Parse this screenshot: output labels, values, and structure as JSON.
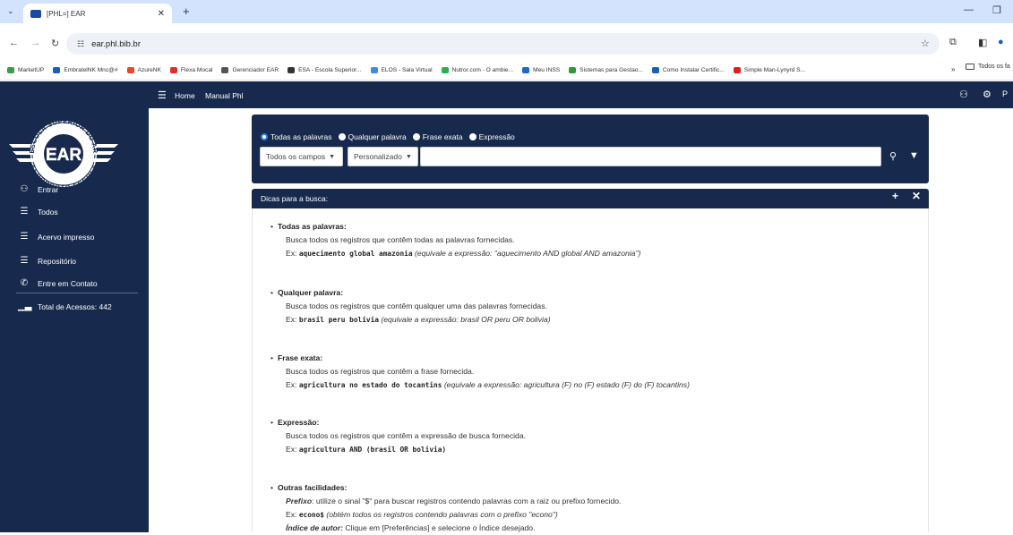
{
  "browser": {
    "tab_title": "[PHL=] EAR",
    "tab_list_icon": "chevron-down-icon",
    "url": "ear.phl.bib.br",
    "bookmarks": [
      {
        "label": "MarketUP",
        "color": "#3c9a4a"
      },
      {
        "label": "EmbratelNK Mnc@#",
        "color": "#1a5fb4"
      },
      {
        "label": "AzureNK",
        "color": "#e24a2a"
      },
      {
        "label": "Flexa Mocal",
        "color": "#e0302c"
      },
      {
        "label": "Gerenciador EAR",
        "color": "#555555"
      },
      {
        "label": "ESA - Escola Superior...",
        "color": "#333333"
      },
      {
        "label": "ELOS - Sala Virtual",
        "color": "#3a8fd8"
      },
      {
        "label": "Nutror.com - O ambie...",
        "color": "#2ab04a"
      },
      {
        "label": "Meu INSS",
        "color": "#1b6ac9"
      },
      {
        "label": "Sistemas para Gestao...",
        "color": "#2a9a3a"
      },
      {
        "label": "Como Instalar Certific...",
        "color": "#1a5fb4"
      },
      {
        "label": "Simple Man-Lynyrd S...",
        "color": "#e02020"
      }
    ],
    "bookmarks_more": "»",
    "bookmarks_folder": "Todos os fa"
  },
  "header": {
    "home": "Home",
    "manual": "Manual Phl",
    "right_text": "P"
  },
  "logo": {
    "top_text": "ESCOLA SUPERIOR DO AR",
    "center_text": "EAR",
    "bottom_text": "AEROPORTO ESCOLA"
  },
  "sidebar": {
    "items": [
      {
        "label": "Entrar",
        "icon": "user-icon"
      },
      {
        "label": "Todos",
        "icon": "stack-icon"
      },
      {
        "label": "Acervo impresso",
        "icon": "stack-icon"
      },
      {
        "label": "Repositório",
        "icon": "stack-icon"
      },
      {
        "label": "Entre em Contato",
        "icon": "phone-icon"
      }
    ],
    "total_label": "Total de Acessos: 442"
  },
  "search": {
    "radios": [
      "Todas as palavras",
      "Qualquer palavra",
      "Frase exata",
      "Expressão"
    ],
    "selected_radio": 0,
    "field_select": "Todos os campos",
    "mode_select": "Personalizado",
    "query": ""
  },
  "tips": {
    "header": "Dicas para a busca:",
    "items": [
      {
        "title": "Todas as palavras:",
        "desc": "Busca todos os registros que contêm todas as palavras fornecidas.",
        "ex_prefix": "Ex:",
        "ex_code": "aquecimento global amazonia",
        "ex_note": "(equivale a expressão: \"aquecimento AND global AND amazonia\")"
      },
      {
        "title": "Qualquer palavra:",
        "desc": "Busca todos os registros que contêm qualquer uma das palavras fornecidas.",
        "ex_prefix": "Ex:",
        "ex_code": "brasil peru bolivia",
        "ex_note": "(equivale a expressão: brasil OR peru OR bolivia)"
      },
      {
        "title": "Frase exata:",
        "desc": "Busca todos os registros que contêm a frase fornecida.",
        "ex_prefix": "Ex:",
        "ex_code": "agricultura no estado do tocantins",
        "ex_note": "(equivale a expressão: agricultura (F) no (F) estado (F) do (F) tocantins)"
      },
      {
        "title": "Expressão:",
        "desc": "Busca todos os registros que contêm a expressão de busca fornecida.",
        "ex_prefix": "Ex:",
        "ex_code": "agricultura AND (brasil OR bolivia)",
        "ex_note": ""
      }
    ],
    "other": {
      "title": "Outras facilidades:",
      "prefix_label": "Prefixo",
      "prefix_desc": ": utilize o sinal \"$\" para buscar registros contendo palavras com a raiz ou prefixo fornecido.",
      "ex_prefix": "Ex:",
      "ex_code": "econo$",
      "ex_note": "(obtém todos os registros contendo palavras com o prefixo \"econo\")",
      "author_label": "Índice de autor:",
      "author_desc": " Clique em [Preferências] e selecione o Índice desejado."
    }
  },
  "colors": {
    "navy": "#172a4d",
    "radio_accent": "#2d7de0"
  }
}
